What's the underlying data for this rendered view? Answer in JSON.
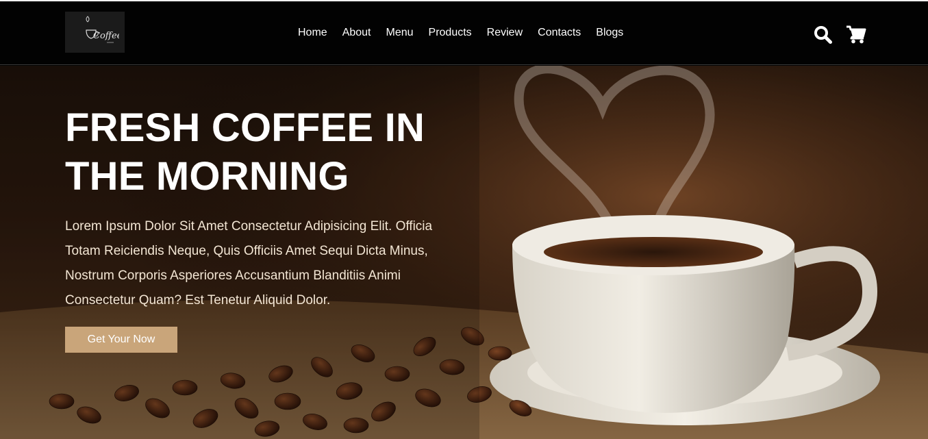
{
  "logo": {
    "text": "Coffee"
  },
  "nav": {
    "items": [
      "Home",
      "About",
      "Menu",
      "Products",
      "Review",
      "Contacts",
      "Blogs"
    ]
  },
  "header_icons": [
    "search-icon",
    "cart-icon"
  ],
  "hero": {
    "title_line1": "FRESH COFFEE IN",
    "title_line2": "THE MORNING",
    "description": "Lorem Ipsum Dolor Sit Amet Consectetur Adipisicing Elit. Officia Totam Reiciendis Neque, Quis Officiis Amet Sequi Dicta Minus, Nostrum Corporis Asperiores Accusantium Blanditiis Animi Consectetur Quam? Est Tenetur Aliquid Dolor.",
    "cta_label": "Get Your Now"
  },
  "colors": {
    "header_bg": "#020202",
    "accent": "#c9a57a",
    "hero_text": "#f3e6d4"
  }
}
